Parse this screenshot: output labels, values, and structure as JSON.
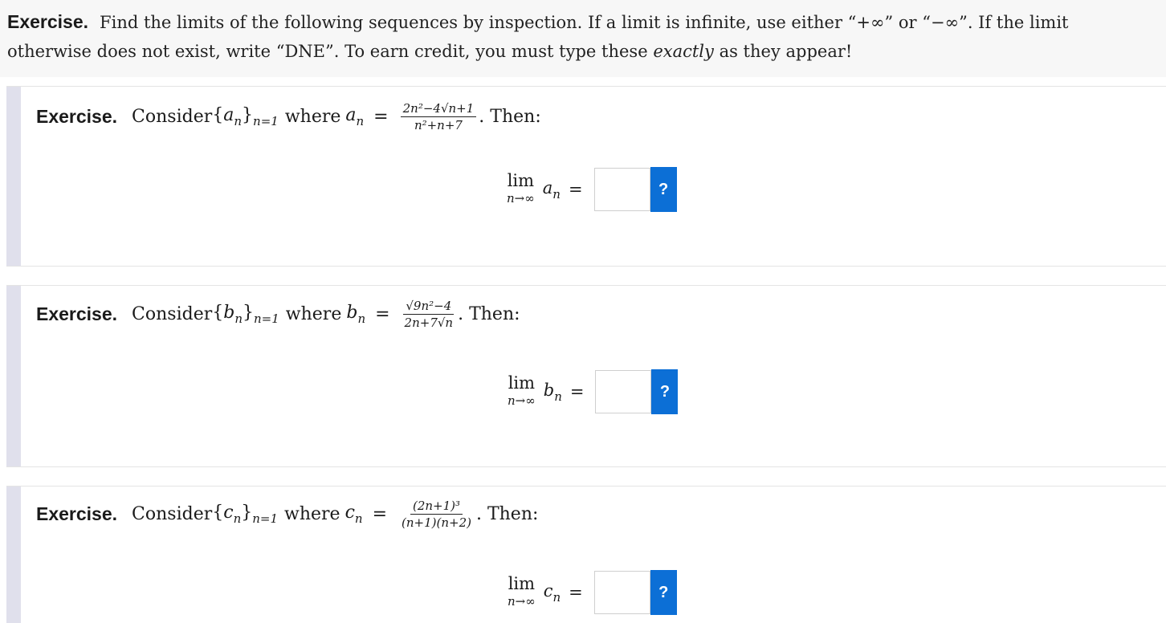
{
  "intro": {
    "label": "Exercise.",
    "text1": "Find the limits of the following sequences by inspection. If a limit is infinite, use either “+∞” or “−∞”. If the limit otherwise does not exist, write “DNE”. To earn credit, you must type these",
    "emph": "exactly",
    "text2": "as they appear!"
  },
  "exercises": [
    {
      "label": "Exercise.",
      "consider": "Consider",
      "seq": "{aₙ}",
      "seq_letter": "a",
      "seq_sub": "n=1",
      "where": "where",
      "term_letter": "a",
      "num": "2n²−4√n+1",
      "den": "n²+n+7",
      "then": "Then:",
      "lim_word": "lim",
      "lim_sub": "n→∞",
      "lim_var": "a",
      "answer_value": "",
      "help_label": "?"
    },
    {
      "label": "Exercise.",
      "consider": "Consider",
      "seq_letter": "b",
      "seq_sub": "n=1",
      "where": "where",
      "term_letter": "b",
      "num": "√9n²−4",
      "den": "2n+7√n",
      "then": "Then:",
      "lim_word": "lim",
      "lim_sub": "n→∞",
      "lim_var": "b",
      "answer_value": "",
      "help_label": "?"
    },
    {
      "label": "Exercise.",
      "consider": "Consider",
      "seq_letter": "c",
      "seq_sub": "n=1",
      "where": "where",
      "term_letter": "c",
      "num": "(2n+1)³",
      "den": "(n+1)(n+2)",
      "then": "Then:",
      "lim_word": "lim",
      "lim_sub": "n→∞",
      "lim_var": "c",
      "answer_value": "",
      "help_label": "?"
    }
  ],
  "colors": {
    "help_button": "#0c6fd6",
    "side_bar": "#e0e0ec",
    "intro_bg": "#f7f7f7"
  }
}
